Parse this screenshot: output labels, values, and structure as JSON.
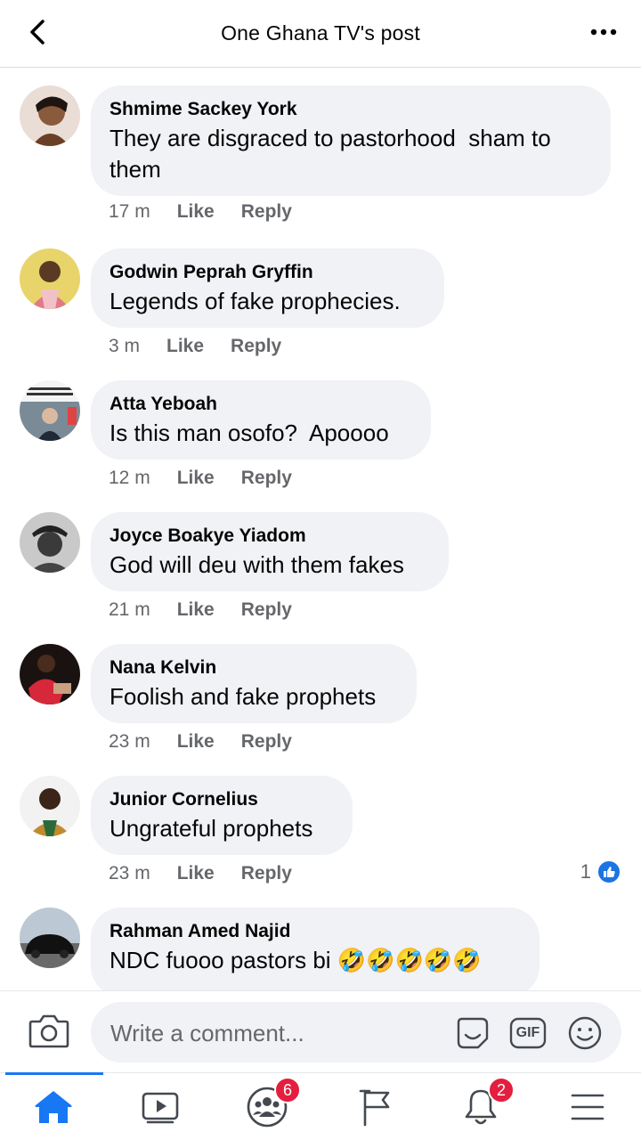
{
  "header": {
    "title": "One Ghana TV's post"
  },
  "comments": [
    {
      "author": "Shmime Sackey York",
      "text": "They are disgraced to pastorhood  sham to\nthem",
      "time": "17 m",
      "like": "Like",
      "reply": "Reply"
    },
    {
      "author": "Godwin Peprah Gryffin",
      "text": "Legends of fake prophecies.",
      "time": "3 m",
      "like": "Like",
      "reply": "Reply"
    },
    {
      "author": "Atta Yeboah",
      "text": "Is this man osofo?  Apoooo",
      "time": "12 m",
      "like": "Like",
      "reply": "Reply"
    },
    {
      "author": "Joyce Boakye Yiadom",
      "text": "God will deu with them fakes",
      "time": "21 m",
      "like": "Like",
      "reply": "Reply"
    },
    {
      "author": "Nana Kelvin",
      "text": "Foolish and fake prophets",
      "time": "23 m",
      "like": "Like",
      "reply": "Reply"
    },
    {
      "author": "Junior Cornelius",
      "text": "Ungrateful prophets",
      "time": "23 m",
      "like": "Like",
      "reply": "Reply",
      "reaction_count": "1"
    },
    {
      "author": "Rahman Amed Najid",
      "text": "NDC fuooo pastors bi 🤣🤣🤣🤣🤣"
    }
  ],
  "composer": {
    "placeholder": "Write a comment...",
    "gif_label": "GIF"
  },
  "nav": {
    "groups_badge": "6",
    "notifications_badge": "2"
  },
  "colors": {
    "accent": "#1877f2",
    "bubble": "#f0f2f5",
    "badge": "#e41e3f"
  }
}
